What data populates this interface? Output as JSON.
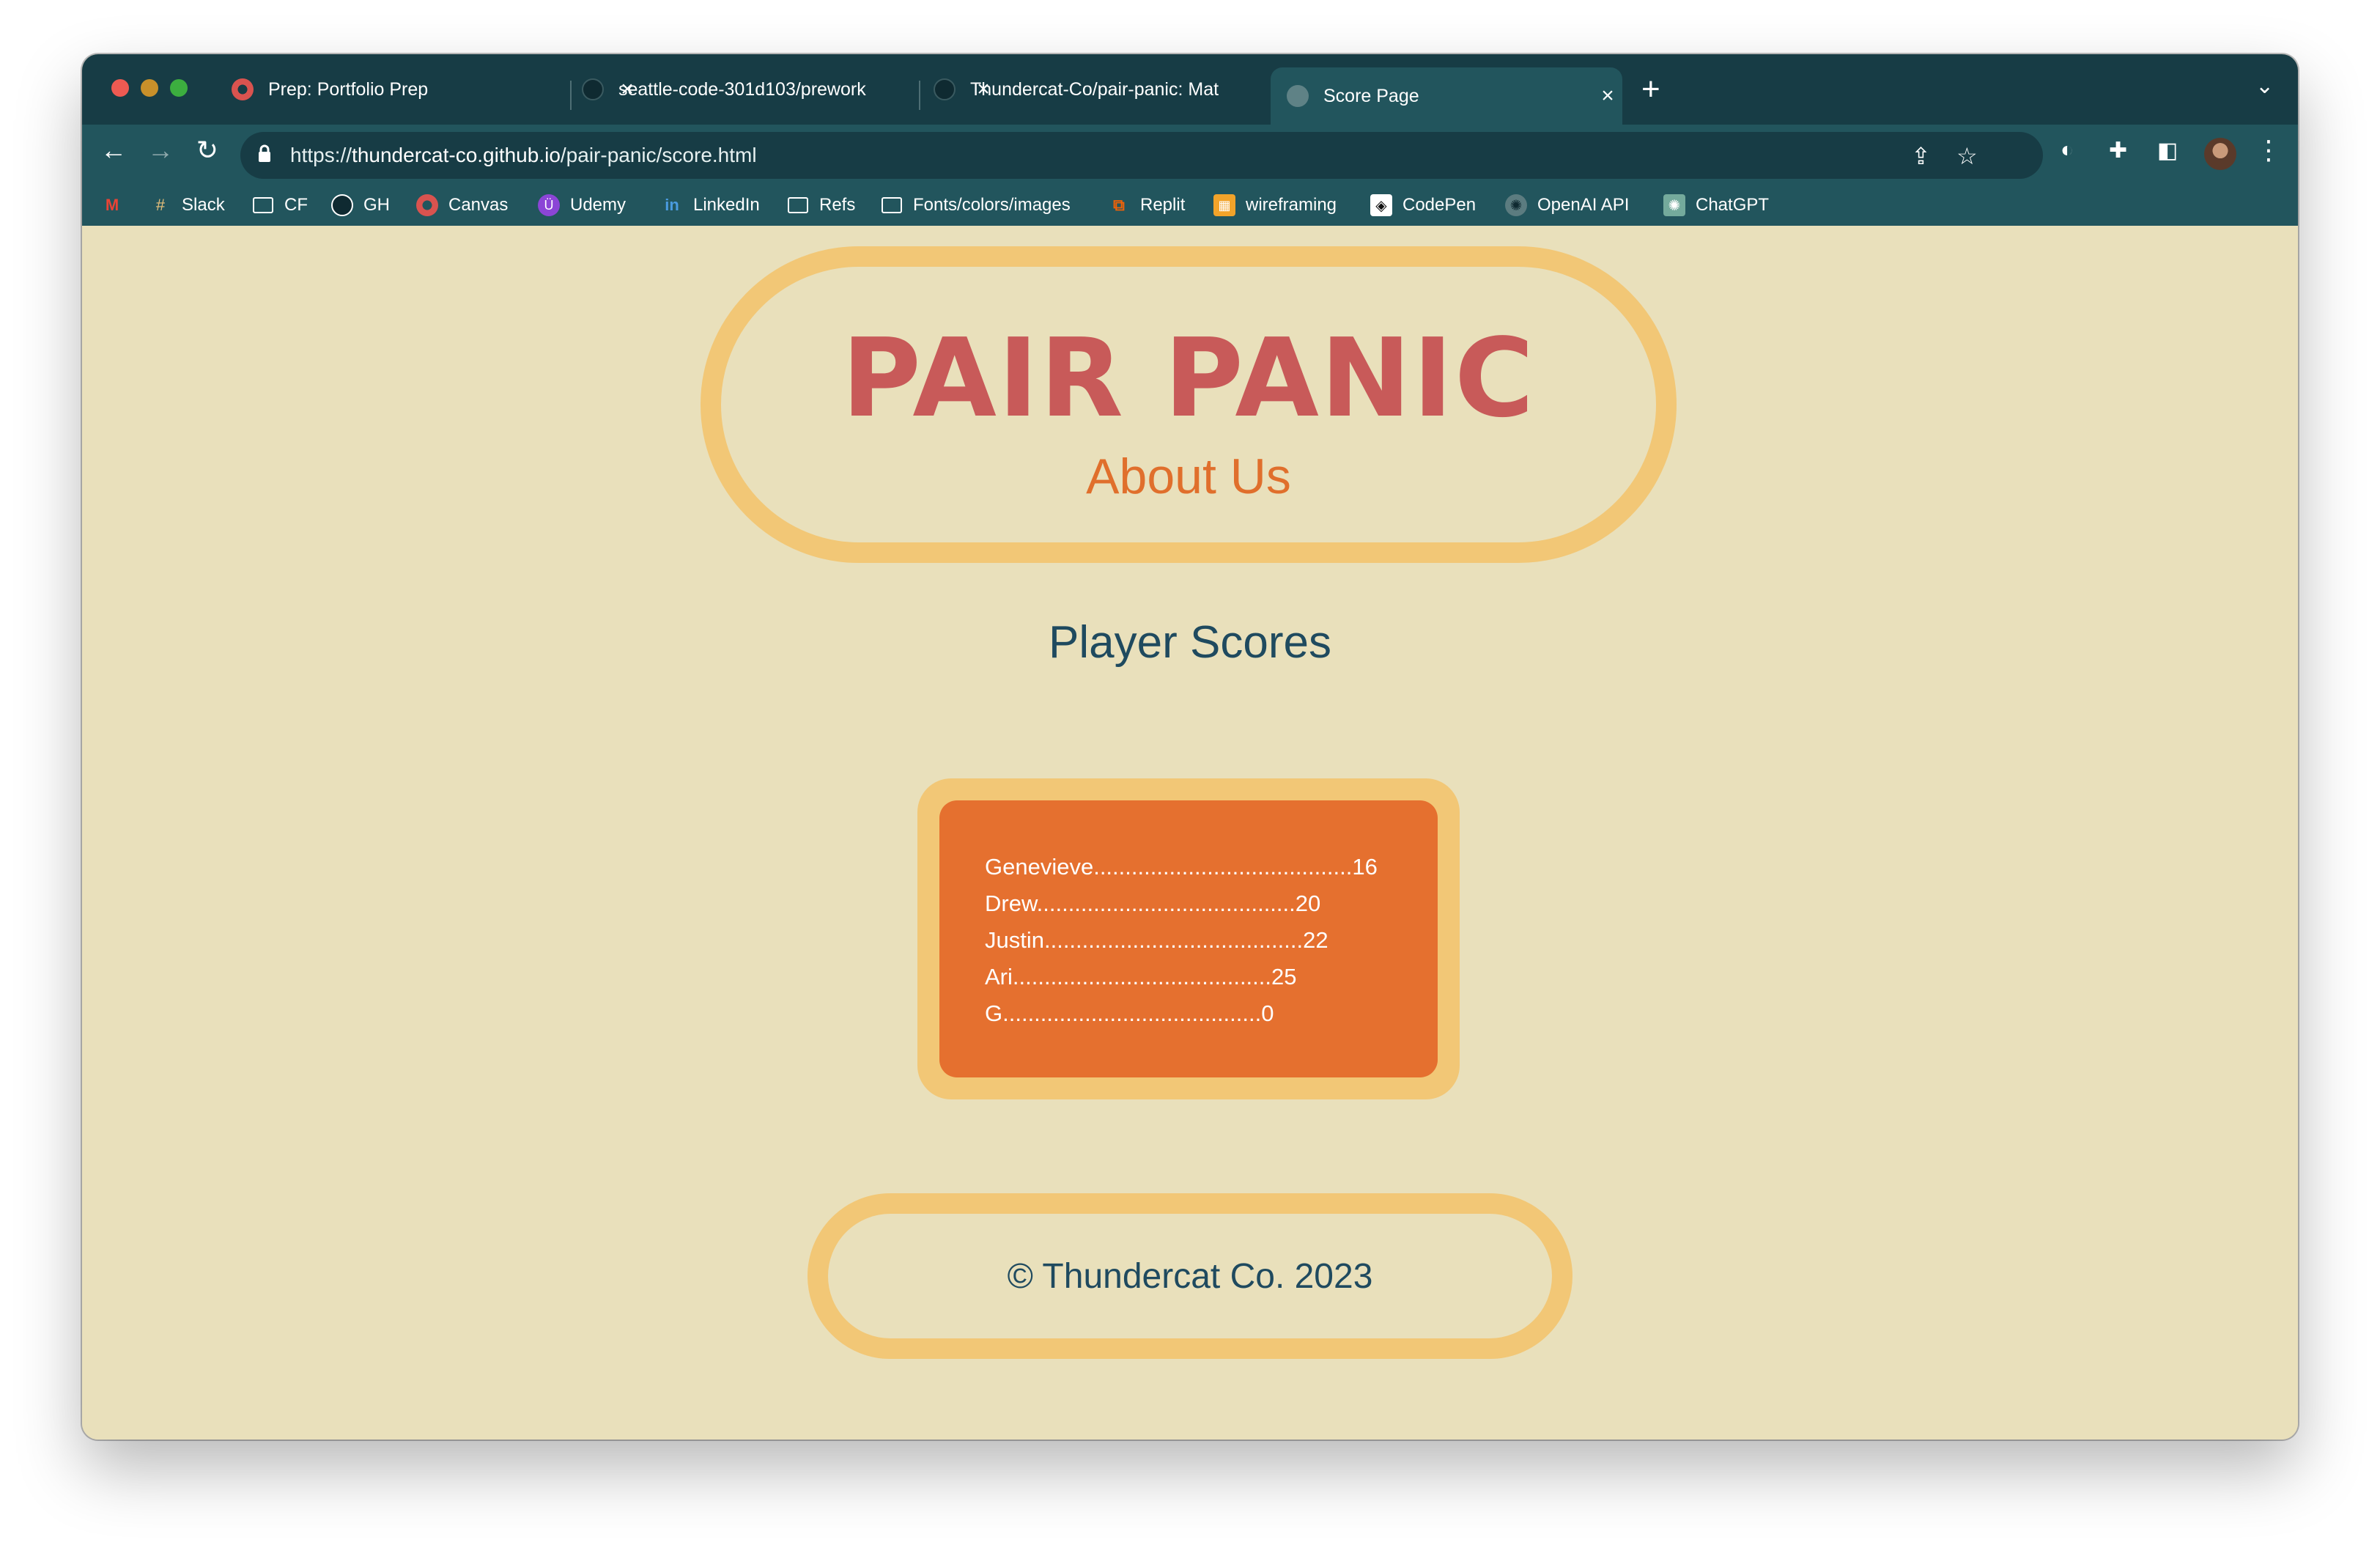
{
  "browser": {
    "tabs": [
      {
        "title": "Prep: Portfolio Prep",
        "icon": "canvas-icon",
        "active": false
      },
      {
        "title": "seattle-code-301d103/prework",
        "icon": "github-icon",
        "active": false
      },
      {
        "title": "Thundercat-Co/pair-panic: Mat",
        "icon": "github-icon",
        "active": false
      },
      {
        "title": "Score Page",
        "icon": "globe-icon",
        "active": true
      }
    ],
    "url_prefix": "https://",
    "url_host": "thundercat-co.github.io",
    "url_path": "/pair-panic/score.html",
    "bookmarks": [
      {
        "label": "",
        "icon": "gmail-icon"
      },
      {
        "label": "Slack",
        "icon": "slack-icon"
      },
      {
        "label": "CF",
        "icon": "folder-icon"
      },
      {
        "label": "GH",
        "icon": "github-icon"
      },
      {
        "label": "Canvas",
        "icon": "canvas-icon"
      },
      {
        "label": "Udemy",
        "icon": "udemy-icon"
      },
      {
        "label": "LinkedIn",
        "icon": "linkedin-icon"
      },
      {
        "label": "Refs",
        "icon": "folder-icon"
      },
      {
        "label": "Fonts/colors/images",
        "icon": "folder-icon"
      },
      {
        "label": "Replit",
        "icon": "replit-icon"
      },
      {
        "label": "wireframing",
        "icon": "wireframing-icon"
      },
      {
        "label": "CodePen",
        "icon": "codepen-icon"
      },
      {
        "label": "OpenAI API",
        "icon": "openai-icon"
      },
      {
        "label": "ChatGPT",
        "icon": "chatgpt-icon"
      }
    ]
  },
  "page": {
    "title": "PAIR PANIC",
    "about_link": "About Us",
    "section_title": "Player Scores",
    "scores": [
      "Genevieve.........................................16",
      "Drew.........................................20",
      "Justin.........................................22",
      "Ari.........................................25",
      "G.........................................0"
    ],
    "footer": "© Thundercat Co. 2023"
  },
  "colors": {
    "title": "#c85a59",
    "about": "#e06f2c",
    "border": "#f2c776",
    "score_box": "#e5702f",
    "text_dark": "#1f4a5f",
    "background": "#e9e0bb",
    "browser_chrome": "#22555d"
  }
}
